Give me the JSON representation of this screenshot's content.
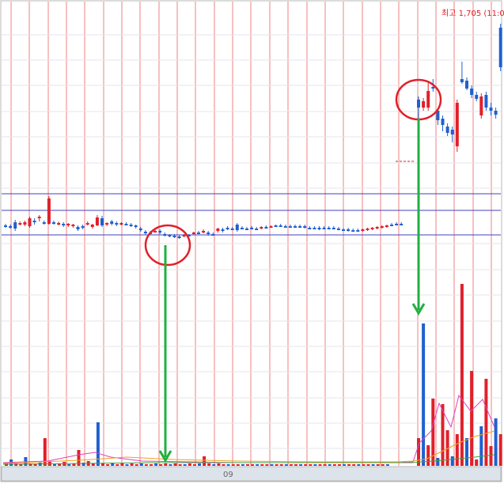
{
  "chart_data": {
    "type": "candlestick",
    "high_label": "최고 1,705 (11:0",
    "x_tick_label": "09",
    "colors": {
      "up": "#e0202a",
      "down": "#2060d0",
      "gridline": "#f08080",
      "hline": "#4040c0",
      "circle": "#e0202a",
      "arrow": "#20b040",
      "ma_pink": "#e040c0",
      "ma_orange": "#f0a020",
      "ma_green": "#40a040"
    },
    "grid": true,
    "candles_left": [
      {
        "o": 285,
        "c": 285,
        "h": 283,
        "l": 288
      },
      {
        "o": 286,
        "c": 286,
        "h": 284,
        "l": 289
      },
      {
        "o": 281,
        "c": 289,
        "h": 278,
        "l": 292
      },
      {
        "o": 283,
        "c": 282,
        "h": 280,
        "l": 285
      },
      {
        "o": 284,
        "c": 281,
        "h": 279,
        "l": 286
      },
      {
        "o": 286,
        "c": 276,
        "h": 274,
        "l": 288
      },
      {
        "o": 279,
        "c": 280,
        "h": 276,
        "l": 284
      },
      {
        "o": 276,
        "c": 274,
        "h": 272,
        "l": 280
      },
      {
        "o": 281,
        "c": 281,
        "h": 279,
        "l": 284
      },
      {
        "o": 283,
        "c": 251,
        "h": 248,
        "l": 284
      },
      {
        "o": 281,
        "c": 283,
        "h": 279,
        "l": 284
      },
      {
        "o": 283,
        "c": 282,
        "h": 280,
        "l": 285
      },
      {
        "o": 283,
        "c": 285,
        "h": 281,
        "l": 287
      },
      {
        "o": 285,
        "c": 283,
        "h": 282,
        "l": 287
      },
      {
        "o": 286,
        "c": 284,
        "h": 283,
        "l": 288
      },
      {
        "o": 287,
        "c": 290,
        "h": 285,
        "l": 292
      },
      {
        "o": 286,
        "c": 288,
        "h": 284,
        "l": 290
      },
      {
        "o": 283,
        "c": 282,
        "h": 280,
        "l": 285
      },
      {
        "o": 287,
        "c": 284,
        "h": 283,
        "l": 289
      },
      {
        "o": 285,
        "c": 275,
        "h": 272,
        "l": 286
      },
      {
        "o": 276,
        "c": 285,
        "h": 273,
        "l": 287
      },
      {
        "o": 284,
        "c": 282,
        "h": 281,
        "l": 286
      },
      {
        "o": 280,
        "c": 283,
        "h": 278,
        "l": 285
      },
      {
        "o": 282,
        "c": 284,
        "h": 280,
        "l": 286
      },
      {
        "o": 283,
        "c": 282,
        "h": 281,
        "l": 285
      },
      {
        "o": 283,
        "c": 283,
        "h": 281,
        "l": 285
      },
      {
        "o": 284,
        "c": 285,
        "h": 282,
        "l": 287
      },
      {
        "o": 285,
        "c": 287,
        "h": 284,
        "l": 289
      },
      {
        "o": 289,
        "c": 291,
        "h": 287,
        "l": 293
      },
      {
        "o": 293,
        "c": 295,
        "h": 291,
        "l": 297
      },
      {
        "o": 294,
        "c": 296,
        "h": 292,
        "l": 297
      },
      {
        "o": 293,
        "c": 292,
        "h": 291,
        "l": 294
      },
      {
        "o": 292,
        "c": 294,
        "h": 290,
        "l": 296
      },
      {
        "o": 296,
        "c": 297,
        "h": 294,
        "l": 299
      },
      {
        "o": 297,
        "c": 298,
        "h": 296,
        "l": 300
      },
      {
        "o": 298,
        "c": 299,
        "h": 296,
        "l": 301
      },
      {
        "o": 299,
        "c": 300,
        "h": 297,
        "l": 302
      },
      {
        "o": 299,
        "c": 297,
        "h": 296,
        "l": 300
      },
      {
        "o": 297,
        "c": 297,
        "h": 296,
        "l": 299
      },
      {
        "o": 296,
        "c": 294,
        "h": 293,
        "l": 297
      },
      {
        "o": 294,
        "c": 294,
        "h": 292,
        "l": 296
      },
      {
        "o": 294,
        "c": 292,
        "h": 290,
        "l": 295
      },
      {
        "o": 294,
        "c": 296,
        "h": 292,
        "l": 298
      },
      {
        "o": 296,
        "c": 296,
        "h": 294,
        "l": 298
      },
      {
        "o": 292,
        "c": 289,
        "h": 288,
        "l": 294
      },
      {
        "o": 290,
        "c": 292,
        "h": 288,
        "l": 294
      },
      {
        "o": 288,
        "c": 289,
        "h": 286,
        "l": 291
      },
      {
        "o": 289,
        "c": 289,
        "h": 287,
        "l": 291
      },
      {
        "o": 284,
        "c": 291,
        "h": 282,
        "l": 293
      },
      {
        "o": 288,
        "c": 288,
        "h": 286,
        "l": 290
      },
      {
        "o": 289,
        "c": 289,
        "h": 287,
        "l": 291
      },
      {
        "o": 288,
        "c": 288,
        "h": 286,
        "l": 290
      },
      {
        "o": 289,
        "c": 289,
        "h": 287,
        "l": 291
      },
      {
        "o": 288,
        "c": 287,
        "h": 286,
        "l": 290
      },
      {
        "o": 287,
        "c": 287,
        "h": 285,
        "l": 289
      },
      {
        "o": 287,
        "c": 286,
        "h": 285,
        "l": 288
      },
      {
        "o": 285,
        "c": 285,
        "h": 284,
        "l": 287
      },
      {
        "o": 285,
        "c": 285,
        "h": 283,
        "l": 287
      },
      {
        "o": 286,
        "c": 286,
        "h": 284,
        "l": 288
      },
      {
        "o": 286,
        "c": 286,
        "h": 284,
        "l": 288
      },
      {
        "o": 286,
        "c": 286,
        "h": 284,
        "l": 288
      },
      {
        "o": 286,
        "c": 286,
        "h": 284,
        "l": 288
      },
      {
        "o": 286,
        "c": 287,
        "h": 284,
        "l": 289
      },
      {
        "o": 288,
        "c": 288,
        "h": 286,
        "l": 290
      },
      {
        "o": 288,
        "c": 288,
        "h": 286,
        "l": 290
      },
      {
        "o": 288,
        "c": 289,
        "h": 286,
        "l": 291
      },
      {
        "o": 288,
        "c": 288,
        "h": 286,
        "l": 290
      },
      {
        "o": 288,
        "c": 288,
        "h": 286,
        "l": 290
      },
      {
        "o": 288,
        "c": 288,
        "h": 286,
        "l": 290
      },
      {
        "o": 289,
        "c": 289,
        "h": 287,
        "l": 291
      },
      {
        "o": 290,
        "c": 290,
        "h": 288,
        "l": 292
      },
      {
        "o": 290,
        "c": 291,
        "h": 288,
        "l": 293
      },
      {
        "o": 291,
        "c": 291,
        "h": 289,
        "l": 293
      },
      {
        "o": 291,
        "c": 291,
        "h": 289,
        "l": 293
      },
      {
        "o": 291,
        "c": 290,
        "h": 289,
        "l": 293
      },
      {
        "o": 290,
        "c": 289,
        "h": 288,
        "l": 292
      },
      {
        "o": 289,
        "c": 288,
        "h": 287,
        "l": 291
      },
      {
        "o": 288,
        "c": 287,
        "h": 286,
        "l": 290
      },
      {
        "o": 287,
        "c": 286,
        "h": 285,
        "l": 289
      },
      {
        "o": 286,
        "c": 285,
        "h": 284,
        "l": 288
      },
      {
        "o": 284,
        "c": 284,
        "h": 282,
        "l": 286
      },
      {
        "o": 283,
        "c": 283,
        "h": 281,
        "l": 285
      },
      {
        "o": 283,
        "c": 283,
        "h": 281,
        "l": 285
      }
    ],
    "candles_right": [
      {
        "o": 126,
        "c": 136,
        "h": 122,
        "l": 150
      },
      {
        "o": 136,
        "c": 128,
        "h": 124,
        "l": 140
      },
      {
        "o": 136,
        "c": 115,
        "h": 104,
        "l": 140
      },
      {
        "o": 110,
        "c": 112,
        "h": 100,
        "l": 116
      },
      {
        "o": 140,
        "c": 152,
        "h": 138,
        "l": 158
      },
      {
        "o": 150,
        "c": 158,
        "h": 146,
        "l": 166
      },
      {
        "o": 160,
        "c": 168,
        "h": 156,
        "l": 172
      },
      {
        "o": 164,
        "c": 170,
        "h": 160,
        "l": 180
      },
      {
        "o": 185,
        "c": 130,
        "h": 126,
        "l": 192
      },
      {
        "o": 100,
        "c": 104,
        "h": 78,
        "l": 106
      },
      {
        "o": 102,
        "c": 112,
        "h": 98,
        "l": 114
      },
      {
        "o": 112,
        "c": 120,
        "h": 108,
        "l": 124
      },
      {
        "o": 120,
        "c": 125,
        "h": 116,
        "l": 128
      },
      {
        "o": 146,
        "c": 122,
        "h": 118,
        "l": 150
      },
      {
        "o": 120,
        "c": 136,
        "h": 116,
        "l": 140
      },
      {
        "o": 136,
        "c": 140,
        "h": 130,
        "l": 146
      },
      {
        "o": 140,
        "c": 145,
        "h": 136,
        "l": 150
      },
      {
        "o": 35,
        "c": 85,
        "h": 30,
        "l": 90
      }
    ],
    "volumes_left": [
      4,
      8,
      3,
      2,
      11,
      3,
      2,
      4,
      35,
      5,
      2,
      3,
      5,
      2,
      3,
      20,
      4,
      6,
      3,
      55,
      3,
      2,
      4,
      2,
      3,
      2,
      3,
      2,
      3,
      2,
      2,
      3,
      2,
      3,
      2,
      3,
      2,
      2,
      3,
      2,
      3,
      12,
      3,
      2,
      3,
      2,
      2,
      2,
      2,
      2,
      2,
      2,
      2,
      2,
      2,
      2,
      2,
      2,
      2,
      2,
      2,
      2,
      2,
      2,
      2,
      2,
      2,
      2,
      2,
      2,
      2,
      2,
      2,
      2,
      2,
      2,
      2,
      2,
      2,
      2
    ],
    "volumes_right": [
      35,
      180,
      26,
      85,
      10,
      78,
      45,
      12,
      40,
      230,
      35,
      120,
      8,
      50,
      110,
      25,
      60,
      40
    ]
  }
}
